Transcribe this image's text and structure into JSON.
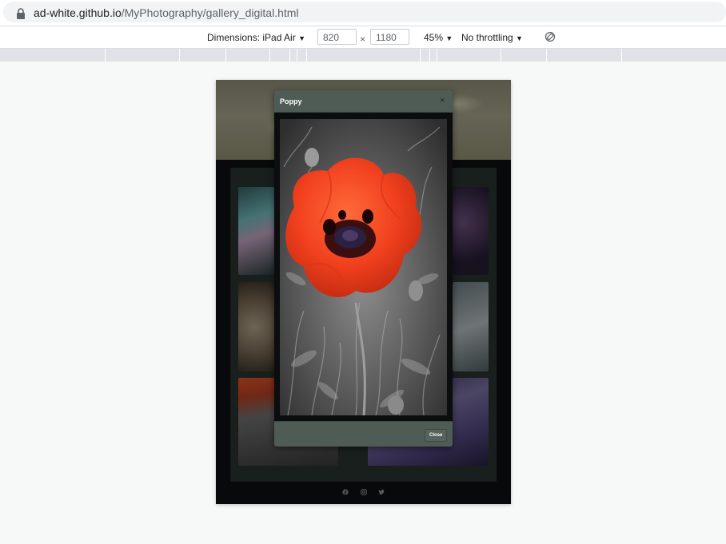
{
  "browser": {
    "url_host": "ad-white.github.io",
    "url_path": "/MyPhotography/gallery_digital.html"
  },
  "device_toolbar": {
    "dimensions_label": "Dimensions: iPad Air",
    "width_value": "820",
    "times": "×",
    "height_value": "1180",
    "zoom": "45%",
    "throttling": "No throttling",
    "dropdown_glyph": "▼"
  },
  "page": {
    "modal": {
      "title": "Poppy",
      "close_glyph": "×",
      "close_button_label": "Close"
    },
    "social_icons": [
      "facebook-icon",
      "instagram-icon",
      "twitter-icon"
    ]
  },
  "colors": {
    "modal_header": "#4f5c55",
    "gallery_panel": "#2f3a35",
    "poppy_red": "#f2411f"
  }
}
